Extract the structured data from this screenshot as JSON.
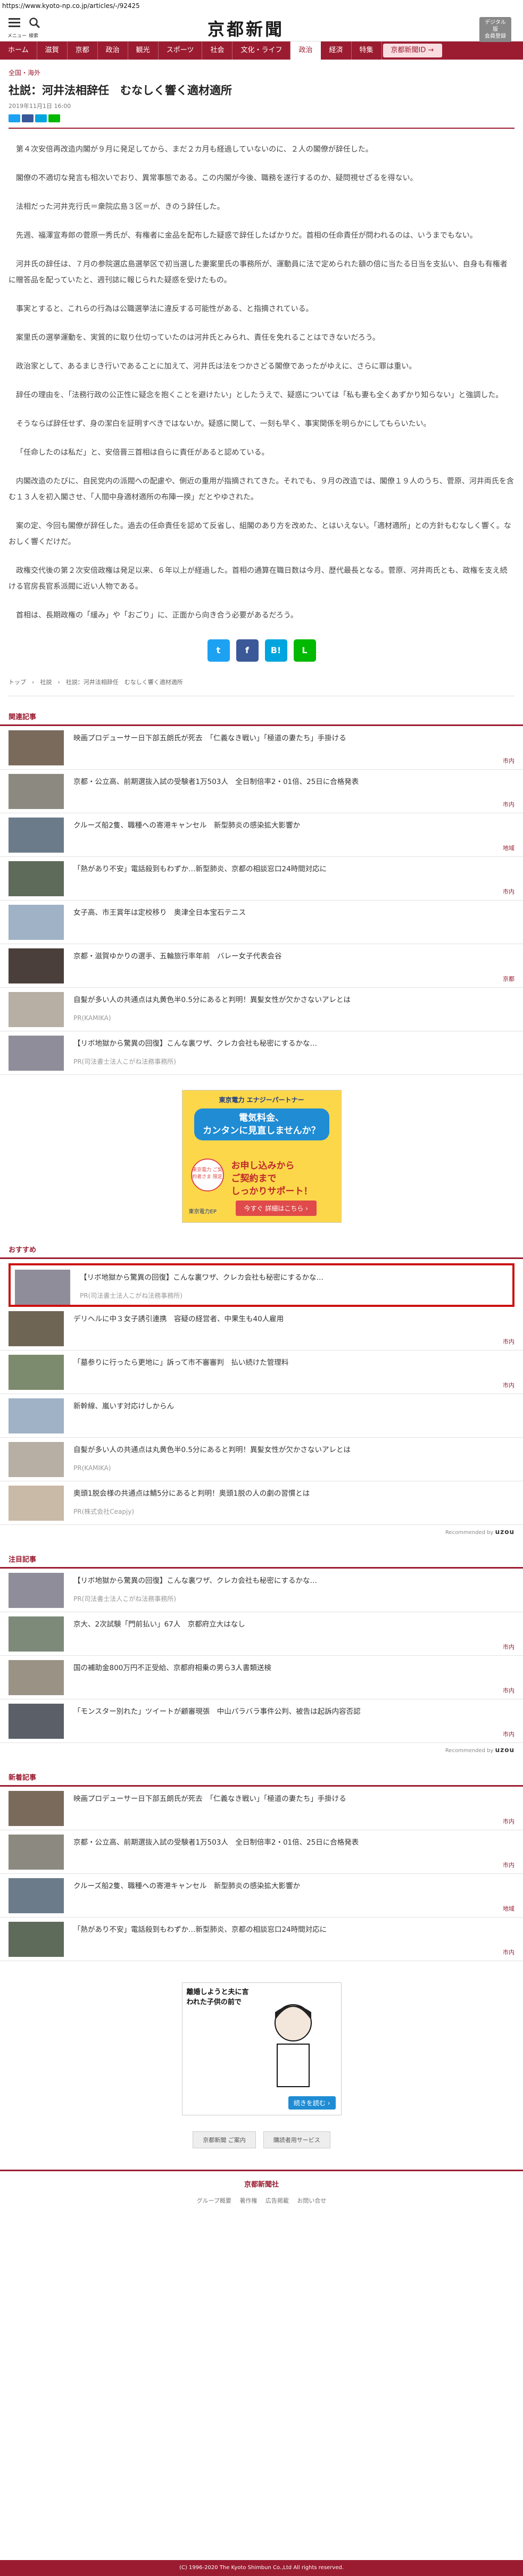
{
  "browser": {
    "url": "https://www.kyoto-np.co.jp/articles/-/92425"
  },
  "header": {
    "menu_label": "メニュー",
    "search_label": "検索",
    "logo": "京都新聞",
    "digital_label_1": "デジタル版",
    "digital_label_2": "会員登録"
  },
  "nav": [
    "ホーム",
    "滋賀",
    "京都",
    "政治",
    "観光",
    "スポーツ",
    "社会",
    "文化・ライフ",
    "政治",
    "経済",
    "特集",
    "京都新聞ID",
    "京都新聞ID →"
  ],
  "article": {
    "category": "全国・海外",
    "title": "社説：河井法相辞任　むなしく響く適材適所",
    "date": "2019年11月1日 16:00",
    "paragraphs": [
      "第４次安倍再改造内閣が９月に発足してから、まだ２カ月も経過していないのに、２人の閣僚が辞任した。",
      "閣僚の不適切な発言も相次いでおり、異常事態である。この内閣が今後、職務を遂行するのか、疑問視せざるを得ない。",
      "法相だった河井克行氏＝衆院広島３区＝が、きのう辞任した。",
      "先週、福澤宣寿郎の菅原一秀氏が、有権者に金品を配布した疑惑で辞任したばかりだ。首相の任命責任が問われるのは、いうまでもない。",
      "河井氏の辞任は、７月の参院選広島選挙区で初当選した妻案里氏の事務所が、運動員に法で定められた額の倍に当たる日当を支払い、自身も有権者に贈答品を配っていたと、週刊誌に報じられた疑惑を受けたもの。",
      "事実とすると、これらの行為は公職選挙法に違反する可能性がある、と指摘されている。",
      "案里氏の選挙運動を、実質的に取り仕切っていたのは河井氏とみられ、責任を免れることはできないだろう。",
      "政治家として、あるまじき行いであることに加えて、河井氏は法をつかさどる閣僚であったがゆえに、さらに罪は重い。",
      "辞任の理由を、「法務行政の公正性に疑念を抱くことを避けたい」としたうえで、疑惑については「私も妻も全くあずかり知らない」と強調した。",
      "そうならば辞任せず、身の潔白を証明すべきではないか。疑惑に関して、一刻も早く、事実関係を明らかにしてもらいたい。",
      "「任命したのは私だ」と、安倍晋三首相は自らに責任があると認めている。",
      "内閣改造のたびに、自民党内の派閥への配慮や、側近の重用が指摘されてきた。それでも、９月の改造では、閣僚１９人のうち、菅原、河井両氏を含む１３人を初入閣させ、「人間中身適材適所の布陣一揆」だとやゆされた。",
      "案の定、今回も閣僚が辞任した。過去の任命責任を認めて反省し、組閣のあり方を改めた、とはいえない。「適材適所」との方針もむなしく響く。なおしく響くだけだ。",
      "政権交代後の第２次安倍政権は発足以来、６年以上が経過した。首相の通算在職日数は今月、歴代最長となる。菅原、河井両氏とも、政権を支え続ける官房長官系派閥に近い人物である。",
      "首相は、長期政権の「緩み」や「おごり」に、正面から向き合う必要があるだろう。"
    ]
  },
  "share": {
    "twitter": "t",
    "facebook": "f",
    "hatena": "B!",
    "line": "L"
  },
  "breadcrumb": "トップ　›　社説　›　社説：河井法相辞任　むなしく響く適材適所",
  "related": {
    "title": "関連記事",
    "items": [
      {
        "text": "映画プロデューサー日下部五朗氏が死去　「仁義なき戦い」「極道の妻たち」手掛ける",
        "tag": "市内"
      },
      {
        "text": "京都・公立高、前期選抜入試の受験者1万503人　全日制倍率2・01倍、25日に合格発表",
        "tag": "市内"
      },
      {
        "text": "クルーズ船2隻、職種への寄港キャンセル　新型肺炎の感染拡大影響か",
        "tag": "地域"
      },
      {
        "text": "「熱があり不安」電話殺到もわずか…新型肺炎、京都の相談窓口24時間対応に",
        "tag": "市内"
      },
      {
        "text": "女子高、市王賞年は定校移り　奥津全日本宝石テニス",
        "tag": ""
      },
      {
        "text": "京都・滋賀ゆかりの選手、五輪旅行率年前　バレー女子代表会谷",
        "tag": "京都"
      },
      {
        "text": "自髪が多い人の共通点は丸黄色半0.5分にあると判明！異髪女性が欠かさないアレとは",
        "pr": "PR(KAMIKA)"
      },
      {
        "text": "【リボ地獄から驚異の回復】こんな裏ワザ、クレカ会社も秘密にするかな…",
        "pr": "PR(司法書士法人こがね法務事務所)"
      }
    ]
  },
  "ad": {
    "top_line_1": "東京電力 エナジーパートナー",
    "top_line_2": "電気料金、",
    "top_line_3": "カンタンに見直しませんか？",
    "circle": "東京電力 ご契約者さま 限定",
    "call_1": "お申し込みから",
    "call_2": "ご契約まで",
    "call_3": "しっかりサポート！",
    "button": "今すぐ 詳細はこちら ›",
    "logo": "東京電力EP"
  },
  "recommend": {
    "title": "おすすめ",
    "items": [
      {
        "text": "【リボ地獄から驚異の回復】こんな裏ワザ、クレカ会社も秘密にするかな…",
        "pr": "PR(司法書士法人こがね法務事務所)"
      },
      {
        "text": "デリヘルに中３女子誘引連携　容疑の経営者、中果生も40人雇用",
        "tag": "市内"
      },
      {
        "text": "「墓参りに行ったら更地に」訴って市不審審判　払い続けた管理料",
        "tag": "市内"
      },
      {
        "text": "新幹線、嵐いす対応けしからん",
        "tag": ""
      },
      {
        "text": "自髪が多い人の共通点は丸黄色半0.5分にあると判明！異髪女性が欠かさないアレとは",
        "pr": "PR(KAMIKA)"
      },
      {
        "text": "奥頭1脱会様の共通点は鯖5分にあると判明！奥頭1脱の人の劇の習慣とは",
        "pr": "PR(株式会社Ceapjy)"
      }
    ],
    "powered": "Recommended by",
    "brand": "uzou"
  },
  "popular": {
    "title": "注目記事",
    "items": [
      {
        "text": "【リボ地獄から驚異の回復】こんな裏ワザ、クレカ会社も秘密にするかな…",
        "pr": "PR(司法書士法人こがね法務事務所)"
      },
      {
        "text": "京大、2次試験「門前払い」67人　京都府立大はなし",
        "tag": "市内"
      },
      {
        "text": "国の補助金800万円不正受給、京都府相乗の男ら3人書類送検",
        "tag": "市内"
      },
      {
        "text": "「モンスター別れた」ツイートが顧審現張　中山パラバラ事件公判、被告は起訴内容否認",
        "tag": "市内"
      }
    ],
    "powered": "Recommended by",
    "brand": "uzou"
  },
  "latest": {
    "title": "新着記事",
    "items": [
      {
        "text": "映画プロデューサー日下部五朗氏が死去　「仁義なき戦い」「極道の妻たち」手掛ける",
        "tag": "市内"
      },
      {
        "text": "京都・公立高、前期選抜入試の受験者1万503人　全日制倍率2・01倍、25日に合格発表",
        "tag": "市内"
      },
      {
        "text": "クルーズ船2隻、職種への寄港キャンセル　新型肺炎の感染拡大影響か",
        "tag": "地域"
      },
      {
        "text": "「熱があり不安」電話殺到もわずか…新型肺炎、京都の相談窓口24時間対応に",
        "tag": "市内"
      }
    ]
  },
  "manga_ad": {
    "text": "離婚しようと夫に言われた子供の前で",
    "button": "続きを読む ›"
  },
  "footer": {
    "buttons": [
      "京都新聞 ご案内",
      "購読者用サービス"
    ],
    "logo": "京都新聞社",
    "links": [
      "グループ概要",
      "著作権",
      "広告掲載",
      "お問い合せ"
    ],
    "copyright": "(C) 1996-2020 The Kyoto Shimbun Co.,Ltd All rights reserved."
  },
  "colors": {
    "brand": "#9b1c31",
    "twitter": "#1da1f2",
    "facebook": "#3b5998",
    "hatena": "#00a4de",
    "line": "#00b900"
  }
}
